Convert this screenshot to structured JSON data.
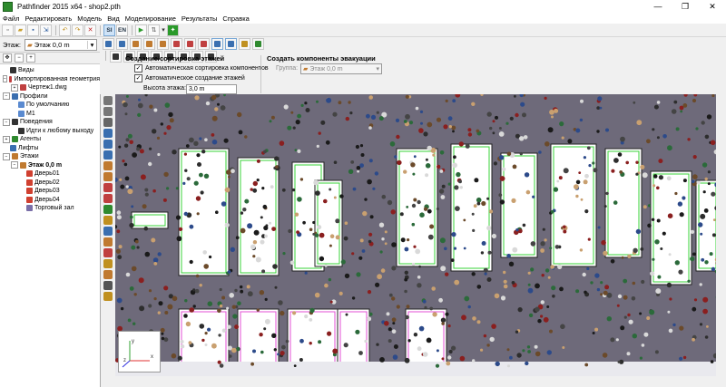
{
  "app": {
    "title": "Pathfinder 2015 x64 - shop2.pth"
  },
  "window_controls": {
    "minimize": "—",
    "maximize": "❐",
    "close": "✕"
  },
  "menu": [
    "Файл",
    "Редактировать",
    "Модель",
    "Вид",
    "Моделирование",
    "Результаты",
    "Справка"
  ],
  "toolbar": {
    "si_label": "SI",
    "en_label": "EN"
  },
  "floor_selector": {
    "label": "Этаж:",
    "value": "Этаж 0,0 m"
  },
  "floor_options": {
    "section_title": "Создание/сортировка этажей",
    "auto_sort": "Автоматическая сортировка компонентов",
    "auto_create": "Автоматическое создание этажей",
    "height_label": "Высота этажа:",
    "height_value": "3,0 m"
  },
  "evac_components": {
    "section_title": "Создать компоненты эвакуации",
    "group_label": "Группа:",
    "group_value": "Этаж 0,0 m"
  },
  "tree": [
    {
      "label": "Виды",
      "indent": 0,
      "color": "#333333",
      "exp": ""
    },
    {
      "label": "Импортированная геометрия",
      "indent": 0,
      "color": "#c04040",
      "exp": "−"
    },
    {
      "label": "Чертеж1.dwg",
      "indent": 1,
      "color": "#c04040",
      "exp": "+"
    },
    {
      "label": "Профили",
      "indent": 0,
      "color": "#3a6fb0",
      "exp": "−"
    },
    {
      "label": "По умолчанию",
      "indent": 1,
      "color": "#5a8ad0",
      "exp": ""
    },
    {
      "label": "М1",
      "indent": 1,
      "color": "#5a8ad0",
      "exp": ""
    },
    {
      "label": "Поведения",
      "indent": 0,
      "color": "#333333",
      "exp": "−"
    },
    {
      "label": "Идти к любому выходу",
      "indent": 1,
      "color": "#333333",
      "exp": ""
    },
    {
      "label": "Агенты",
      "indent": 0,
      "color": "#2f8a2f",
      "exp": "+"
    },
    {
      "label": "Лифты",
      "indent": 0,
      "color": "#3a6fb0",
      "exp": ""
    },
    {
      "label": "Этажи",
      "indent": 0,
      "color": "#c07a30",
      "exp": "−"
    },
    {
      "label": "Этаж 0,0 m",
      "indent": 1,
      "color": "#c07a30",
      "exp": "−",
      "bold": true
    },
    {
      "label": "Дверь01",
      "indent": 2,
      "color": "#d04030",
      "exp": ""
    },
    {
      "label": "Дверь02",
      "indent": 2,
      "color": "#d04030",
      "exp": ""
    },
    {
      "label": "Дверь03",
      "indent": 2,
      "color": "#d04030",
      "exp": ""
    },
    {
      "label": "Дверь04",
      "indent": 2,
      "color": "#d04030",
      "exp": ""
    },
    {
      "label": "Торговый зал",
      "indent": 2,
      "color": "#7a6fa8",
      "exp": ""
    }
  ],
  "colors": {
    "floor": "#6e6a7a",
    "room_walls": "#ffffff",
    "door_lines": "#39d339",
    "exit_lines": "#e34fd4",
    "axis_x": "#e03030",
    "axis_y": "#30a030",
    "axis_z": "#3030e0"
  },
  "axes": {
    "x": "x",
    "y": "y",
    "z": "z"
  }
}
